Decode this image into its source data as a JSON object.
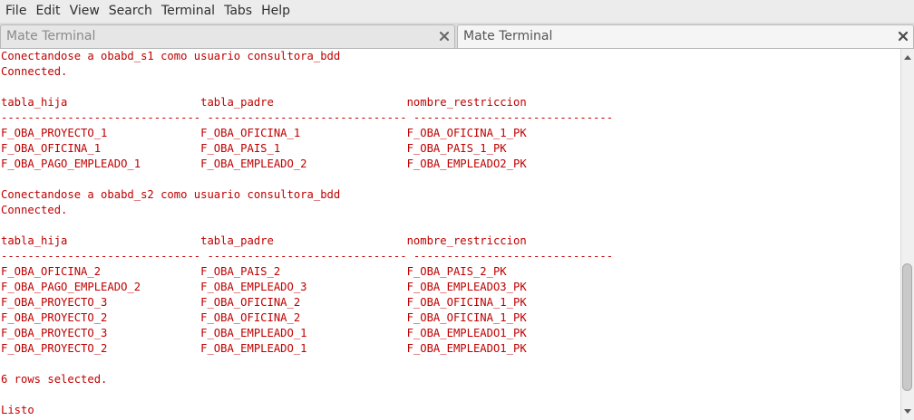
{
  "menubar": {
    "items": [
      "File",
      "Edit",
      "View",
      "Search",
      "Terminal",
      "Tabs",
      "Help"
    ]
  },
  "tabs": [
    {
      "label": "Mate Terminal",
      "active": false
    },
    {
      "label": "Mate Terminal",
      "active": true
    }
  ],
  "icons": {
    "tab_close": "close-icon",
    "scroll_up": "arrow-up-icon",
    "scroll_down": "arrow-down-icon"
  },
  "colors": {
    "terminal_text": "#c00000",
    "terminal_background": "#ffffff"
  },
  "terminal": {
    "lines": [
      "Conectandose a obabd_s1 como usuario consultora_bdd",
      "Connected.",
      "",
      "tabla_hija                    tabla_padre                    nombre_restriccion",
      "------------------------------ ------------------------------ ------------------------------",
      "F_OBA_PROYECTO_1              F_OBA_OFICINA_1                F_OBA_OFICINA_1_PK",
      "F_OBA_OFICINA_1               F_OBA_PAIS_1                   F_OBA_PAIS_1_PK",
      "F_OBA_PAGO_EMPLEADO_1         F_OBA_EMPLEADO_2               F_OBA_EMPLEADO2_PK",
      "",
      "Conectandose a obabd_s2 como usuario consultora_bdd",
      "Connected.",
      "",
      "tabla_hija                    tabla_padre                    nombre_restriccion",
      "------------------------------ ------------------------------ ------------------------------",
      "F_OBA_OFICINA_2               F_OBA_PAIS_2                   F_OBA_PAIS_2_PK",
      "F_OBA_PAGO_EMPLEADO_2         F_OBA_EMPLEADO_3               F_OBA_EMPLEADO3_PK",
      "F_OBA_PROYECTO_3              F_OBA_OFICINA_2                F_OBA_OFICINA_1_PK",
      "F_OBA_PROYECTO_2              F_OBA_OFICINA_2                F_OBA_OFICINA_1_PK",
      "F_OBA_PROYECTO_3              F_OBA_EMPLEADO_1               F_OBA_EMPLEADO1_PK",
      "F_OBA_PROYECTO_2              F_OBA_EMPLEADO_1               F_OBA_EMPLEADO1_PK",
      "",
      "6 rows selected.",
      "",
      "Listo"
    ]
  }
}
